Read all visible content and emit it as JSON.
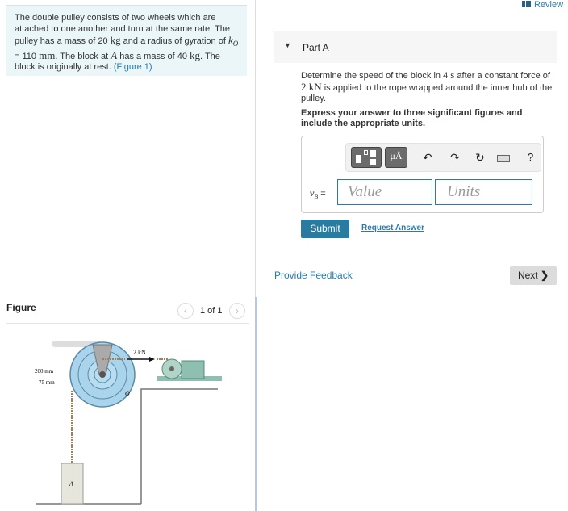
{
  "problem": {
    "text_1": "The double pulley consists of two wheels which are attached to one another and turn at the same rate. The pulley has a mass of 20 ",
    "unit_kg": "kg",
    "text_2": " and a radius of gyration of ",
    "k_symbol": "k",
    "k_sub": "O",
    "text_3": " = 110 ",
    "unit_mm": "mm",
    "text_4": ". The block at ",
    "block": "A",
    "text_5": " has a mass of 40 ",
    "unit_kg2": "kg",
    "text_6": ". The block is originally at rest. ",
    "figure_link": "(Figure 1)"
  },
  "header": {
    "review_label": "Review"
  },
  "part": {
    "label": "Part A",
    "q1": "Determine the speed of the block in 4 ",
    "q_unit_s": "s",
    "q2": " after a constant force of ",
    "q_force": "2 ",
    "q_unit_kN": "kN",
    "q3": " is applied to the rope wrapped around the inner hub of the pulley.",
    "instructions": "Express your answer to three significant figures and include the appropriate units."
  },
  "answer": {
    "variable": "v",
    "variable_sub": "B",
    "equals": " =",
    "value_placeholder": "Value",
    "units_placeholder": "Units",
    "toolbar": {
      "units_label": "μÅ",
      "help": "?",
      "icons": [
        "templates-icon",
        "units-icon",
        "undo-icon",
        "redo-icon",
        "reset-icon",
        "keyboard-icon",
        "help-icon"
      ]
    }
  },
  "actions": {
    "submit": "Submit",
    "request_answer": "Request Answer",
    "provide_feedback": "Provide Feedback",
    "next": "Next"
  },
  "figure": {
    "title": "Figure",
    "pager": "1 of 1",
    "labels": {
      "force": "2 kN",
      "r_outer": "200 mm",
      "r_inner": "75 mm",
      "center": "O",
      "block": "A"
    }
  },
  "colors": {
    "accent": "#2a7ba0",
    "link": "#2a7ab0",
    "problem_bg": "#eaf6f7",
    "pulley": "#a9d4ec",
    "motor": "#8fbfb0"
  }
}
